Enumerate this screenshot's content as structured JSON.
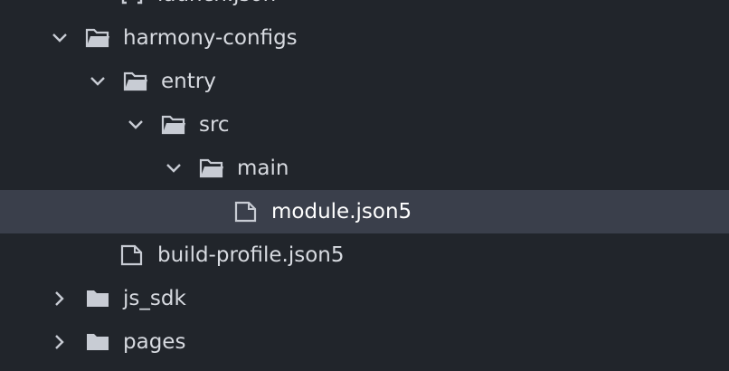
{
  "explorer": {
    "rows": [
      {
        "label": "launch.json",
        "kind": "file",
        "icon": "bracket-file-icon"
      },
      {
        "label": "harmony-configs",
        "kind": "folder",
        "expanded": true,
        "icon": "folder-open-icon"
      },
      {
        "label": "entry",
        "kind": "folder",
        "expanded": true,
        "icon": "folder-open-icon"
      },
      {
        "label": "src",
        "kind": "folder",
        "expanded": true,
        "icon": "folder-open-icon"
      },
      {
        "label": "main",
        "kind": "folder",
        "expanded": true,
        "icon": "folder-open-icon"
      },
      {
        "label": "module.json5",
        "kind": "file",
        "selected": true,
        "icon": "file-icon"
      },
      {
        "label": "build-profile.json5",
        "kind": "file",
        "icon": "file-icon"
      },
      {
        "label": "js_sdk",
        "kind": "folder",
        "expanded": false,
        "icon": "folder-closed-icon"
      },
      {
        "label": "pages",
        "kind": "folder",
        "expanded": false,
        "icon": "folder-closed-icon"
      }
    ]
  },
  "colors": {
    "background": "#21252b",
    "selected_row": "#3a3f4b",
    "text": "#d7dae0",
    "selected_text": "#ffffff",
    "icon": "#c8ccd4"
  }
}
